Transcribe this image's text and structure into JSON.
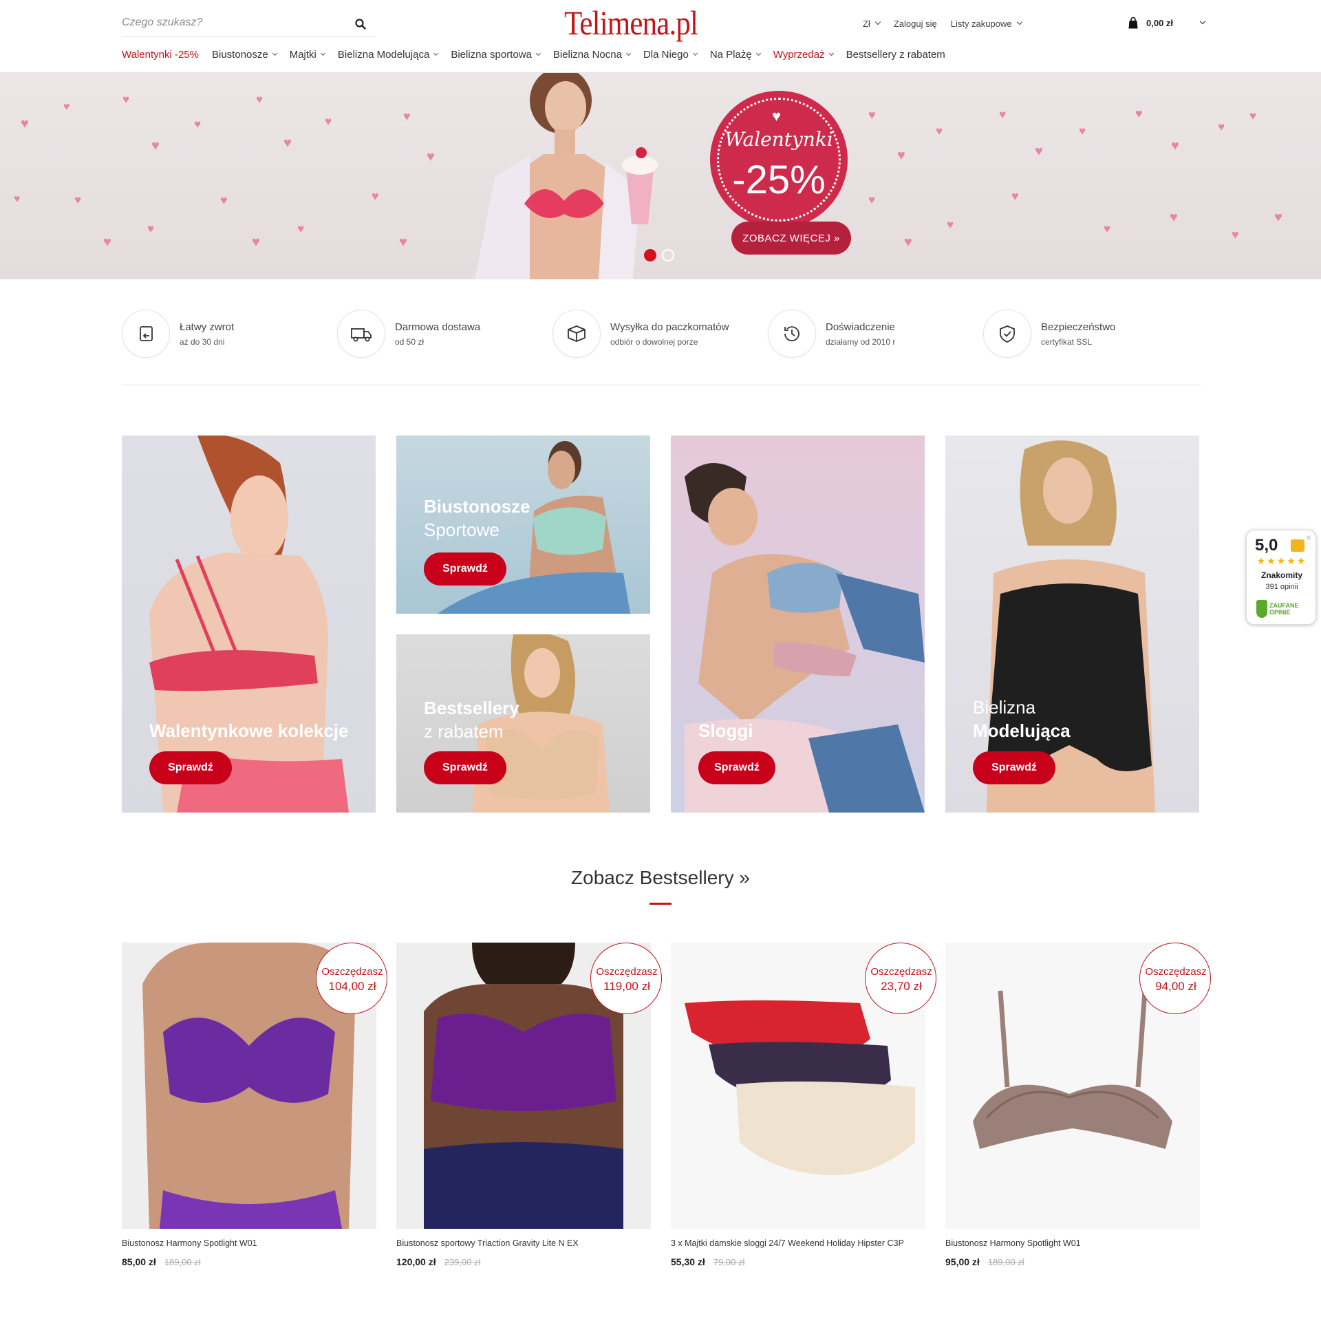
{
  "header": {
    "search_placeholder": "Czego szukasz?",
    "logo": "Telimena.pl",
    "currency": "Zł",
    "login": "Zaloguj się",
    "wishlist": "Listy zakupowe",
    "cart_total": "0,00 zł"
  },
  "nav": [
    {
      "label": "Walentynki -25%",
      "highlight": true,
      "dropdown": false
    },
    {
      "label": "Biustonosze",
      "highlight": false,
      "dropdown": true
    },
    {
      "label": "Majtki",
      "highlight": false,
      "dropdown": true
    },
    {
      "label": "Bielizna Modelująca",
      "highlight": false,
      "dropdown": true
    },
    {
      "label": "Bielizna sportowa",
      "highlight": false,
      "dropdown": true
    },
    {
      "label": "Bielizna Nocna",
      "highlight": false,
      "dropdown": true
    },
    {
      "label": "Dla Niego",
      "highlight": false,
      "dropdown": true
    },
    {
      "label": "Na Plażę",
      "highlight": false,
      "dropdown": true
    },
    {
      "label": "Wyprzedaż",
      "highlight": true,
      "dropdown": true
    },
    {
      "label": "Bestsellery z rabatem",
      "highlight": false,
      "dropdown": false
    }
  ],
  "hero": {
    "badge_title": "Walentynki",
    "badge_discount": "-25%",
    "cta": "ZOBACZ WIĘCEJ »",
    "slides": 2,
    "active_slide": 1
  },
  "features": [
    {
      "icon": "return-icon",
      "title": "Łatwy zwrot",
      "subtitle": "aż do 30 dni"
    },
    {
      "icon": "truck-icon",
      "title": "Darmowa dostawa",
      "subtitle": "od 50 zł"
    },
    {
      "icon": "package-icon",
      "title": "Wysyłka do paczkomatów",
      "subtitle": "odbiór o dowolnej porze"
    },
    {
      "icon": "clock-icon",
      "title": "Doświadczenie",
      "subtitle": "działamy od 2010 r"
    },
    {
      "icon": "shield-check-icon",
      "title": "Bezpieczeństwo",
      "subtitle": "certyfikat SSL"
    }
  ],
  "tiles": {
    "walentynki": {
      "title": "Walentynkowe kolekcje",
      "button": "Sprawdź"
    },
    "sport": {
      "title_bold": "Biustonosze",
      "title_light": "Sportowe",
      "button": "Sprawdź"
    },
    "bestsellers": {
      "title_bold": "Bestsellery",
      "title_light": "z rabatem",
      "button": "Sprawdź"
    },
    "sloggi": {
      "title": "Sloggi",
      "button": "Sprawdź"
    },
    "shapewear": {
      "title_light": "Bielizna",
      "title_bold": "Modelująca",
      "button": "Sprawdź"
    }
  },
  "rating": {
    "score": "5,0",
    "stars": "★★★★★",
    "label": "Znakomity",
    "count": "391 opinii",
    "brand": "ZAUFANE OPINIE",
    "close": "×",
    "accent": "#f2b51c",
    "brand_color": "#5aa92b"
  },
  "bestsellers": {
    "title": "Zobacz Bestsellery »",
    "save_label": "Oszczędzasz",
    "products": [
      {
        "name": "Biustonosz Harmony Spotlight W01",
        "price": "85,00 zł",
        "old_price": "189,00 zł",
        "saving": "104,00 zł",
        "color": "#6a2ca0"
      },
      {
        "name": "Biustonosz sportowy Triaction Gravity Lite N EX",
        "price": "120,00 zł",
        "old_price": "239,00 zł",
        "saving": "119,00 zł",
        "color": "#6b1f8e"
      },
      {
        "name": "3 x Majtki damskie sloggi 24/7 Weekend Holiday Hipster C3P",
        "price": "55,30 zł",
        "old_price": "79,00 zł",
        "saving": "23,70 zł",
        "color": "#d9232e"
      },
      {
        "name": "Biustonosz Harmony Spotlight W01",
        "price": "95,00 zł",
        "old_price": "189,00 zł",
        "saving": "94,00 zł",
        "color": "#9b8079"
      }
    ]
  },
  "colors": {
    "brand_red": "#c3141a",
    "button_red": "#c8001a",
    "hero_badge": "#cd2a4c"
  }
}
